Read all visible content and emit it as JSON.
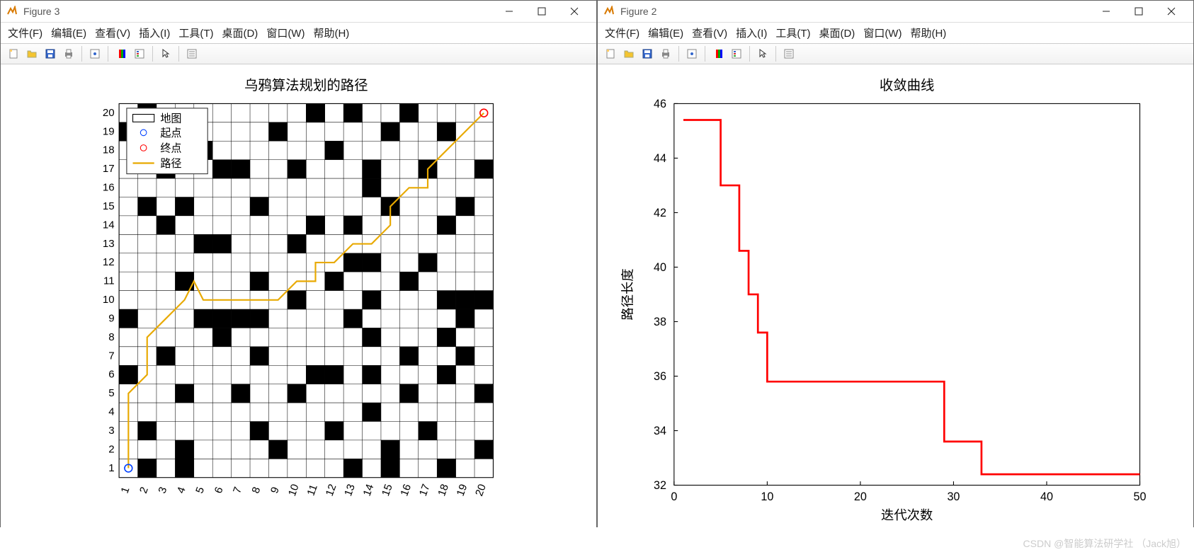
{
  "windows": [
    {
      "title": "Figure 3"
    },
    {
      "title": "Figure 2"
    }
  ],
  "menu": {
    "file": "文件(F)",
    "edit": "编辑(E)",
    "view": "查看(V)",
    "insert": "插入(I)",
    "tools": "工具(T)",
    "desktop": "桌面(D)",
    "window": "窗口(W)",
    "help": "帮助(H)"
  },
  "toolbar_icons": [
    "new-icon",
    "open-icon",
    "save-icon",
    "print-icon",
    "sep",
    "datacursor-icon",
    "sep",
    "colorbar-icon",
    "legend-icon",
    "sep",
    "pointer-icon",
    "sep",
    "properties-icon"
  ],
  "watermark": "CSDN @智能算法研学社 （Jack旭）",
  "chart_data": [
    {
      "type": "grid-path",
      "title": "乌鸦算法规划的路径",
      "xlabel": "",
      "ylabel": "",
      "xticks": [
        1,
        2,
        3,
        4,
        5,
        6,
        7,
        8,
        9,
        10,
        11,
        12,
        13,
        14,
        15,
        16,
        17,
        18,
        19,
        20
      ],
      "yticks": [
        1,
        2,
        3,
        4,
        5,
        6,
        7,
        8,
        9,
        10,
        11,
        12,
        13,
        14,
        15,
        16,
        17,
        18,
        19,
        20
      ],
      "grid_size": 20,
      "legend": {
        "map": "地图",
        "start": "起点",
        "end": "终点",
        "path": "路径"
      },
      "start": [
        1,
        1
      ],
      "end": [
        20,
        20
      ],
      "obstacles": [
        [
          2,
          1
        ],
        [
          4,
          1
        ],
        [
          13,
          1
        ],
        [
          15,
          1
        ],
        [
          18,
          1
        ],
        [
          4,
          2
        ],
        [
          9,
          2
        ],
        [
          15,
          2
        ],
        [
          20,
          2
        ],
        [
          2,
          3
        ],
        [
          8,
          3
        ],
        [
          12,
          3
        ],
        [
          17,
          3
        ],
        [
          14,
          4
        ],
        [
          4,
          5
        ],
        [
          7,
          5
        ],
        [
          10,
          5
        ],
        [
          16,
          5
        ],
        [
          20,
          5
        ],
        [
          1,
          6
        ],
        [
          11,
          6
        ],
        [
          12,
          6
        ],
        [
          14,
          6
        ],
        [
          18,
          6
        ],
        [
          3,
          7
        ],
        [
          8,
          7
        ],
        [
          16,
          7
        ],
        [
          19,
          7
        ],
        [
          6,
          8
        ],
        [
          14,
          8
        ],
        [
          18,
          8
        ],
        [
          1,
          9
        ],
        [
          5,
          9
        ],
        [
          6,
          9
        ],
        [
          7,
          9
        ],
        [
          8,
          9
        ],
        [
          13,
          9
        ],
        [
          19,
          9
        ],
        [
          10,
          10
        ],
        [
          14,
          10
        ],
        [
          18,
          10
        ],
        [
          19,
          10
        ],
        [
          20,
          10
        ],
        [
          4,
          11
        ],
        [
          8,
          11
        ],
        [
          12,
          11
        ],
        [
          16,
          11
        ],
        [
          13,
          12
        ],
        [
          14,
          12
        ],
        [
          17,
          12
        ],
        [
          5,
          13
        ],
        [
          6,
          13
        ],
        [
          10,
          13
        ],
        [
          3,
          14
        ],
        [
          11,
          14
        ],
        [
          13,
          14
        ],
        [
          18,
          14
        ],
        [
          2,
          15
        ],
        [
          4,
          15
        ],
        [
          8,
          15
        ],
        [
          15,
          15
        ],
        [
          19,
          15
        ],
        [
          14,
          16
        ],
        [
          3,
          17
        ],
        [
          6,
          17
        ],
        [
          7,
          17
        ],
        [
          10,
          17
        ],
        [
          14,
          17
        ],
        [
          17,
          17
        ],
        [
          20,
          17
        ],
        [
          5,
          18
        ],
        [
          12,
          18
        ],
        [
          1,
          19
        ],
        [
          4,
          19
        ],
        [
          9,
          19
        ],
        [
          15,
          19
        ],
        [
          18,
          19
        ],
        [
          2,
          20
        ],
        [
          11,
          20
        ],
        [
          13,
          20
        ],
        [
          16,
          20
        ]
      ],
      "path": [
        [
          1,
          1
        ],
        [
          1,
          2
        ],
        [
          1,
          3
        ],
        [
          1,
          4
        ],
        [
          1,
          5
        ],
        [
          2,
          6
        ],
        [
          2,
          7
        ],
        [
          2,
          8
        ],
        [
          3,
          9
        ],
        [
          4,
          10
        ],
        [
          4.5,
          11
        ],
        [
          5,
          10
        ],
        [
          6,
          10
        ],
        [
          7,
          10
        ],
        [
          8,
          10
        ],
        [
          9,
          10
        ],
        [
          10,
          11
        ],
        [
          11,
          11
        ],
        [
          11,
          12
        ],
        [
          12,
          12
        ],
        [
          13,
          13
        ],
        [
          14,
          13
        ],
        [
          15,
          14
        ],
        [
          15,
          15
        ],
        [
          16,
          16
        ],
        [
          17,
          16
        ],
        [
          17,
          17
        ],
        [
          18,
          18
        ],
        [
          19,
          19
        ],
        [
          20,
          20
        ]
      ]
    },
    {
      "type": "line",
      "title": "收敛曲线",
      "xlabel": "迭代次数",
      "ylabel": "路径长度",
      "xlim": [
        0,
        50
      ],
      "ylim": [
        32,
        46
      ],
      "xticks": [
        0,
        10,
        20,
        30,
        40,
        50
      ],
      "yticks": [
        32,
        34,
        36,
        38,
        40,
        42,
        44,
        46
      ],
      "series": [
        {
          "name": "路径长度",
          "color": "#ff0000",
          "x": [
            1,
            5,
            5,
            7,
            7,
            8,
            8,
            9,
            9,
            10,
            10,
            14,
            14,
            29,
            29,
            31,
            31,
            33,
            33,
            50
          ],
          "y": [
            45.4,
            45.4,
            43.0,
            43.0,
            40.6,
            40.6,
            39.0,
            39.0,
            37.6,
            37.6,
            35.8,
            35.8,
            35.8,
            35.8,
            33.6,
            33.6,
            33.6,
            33.6,
            32.4,
            32.4
          ]
        }
      ]
    }
  ]
}
